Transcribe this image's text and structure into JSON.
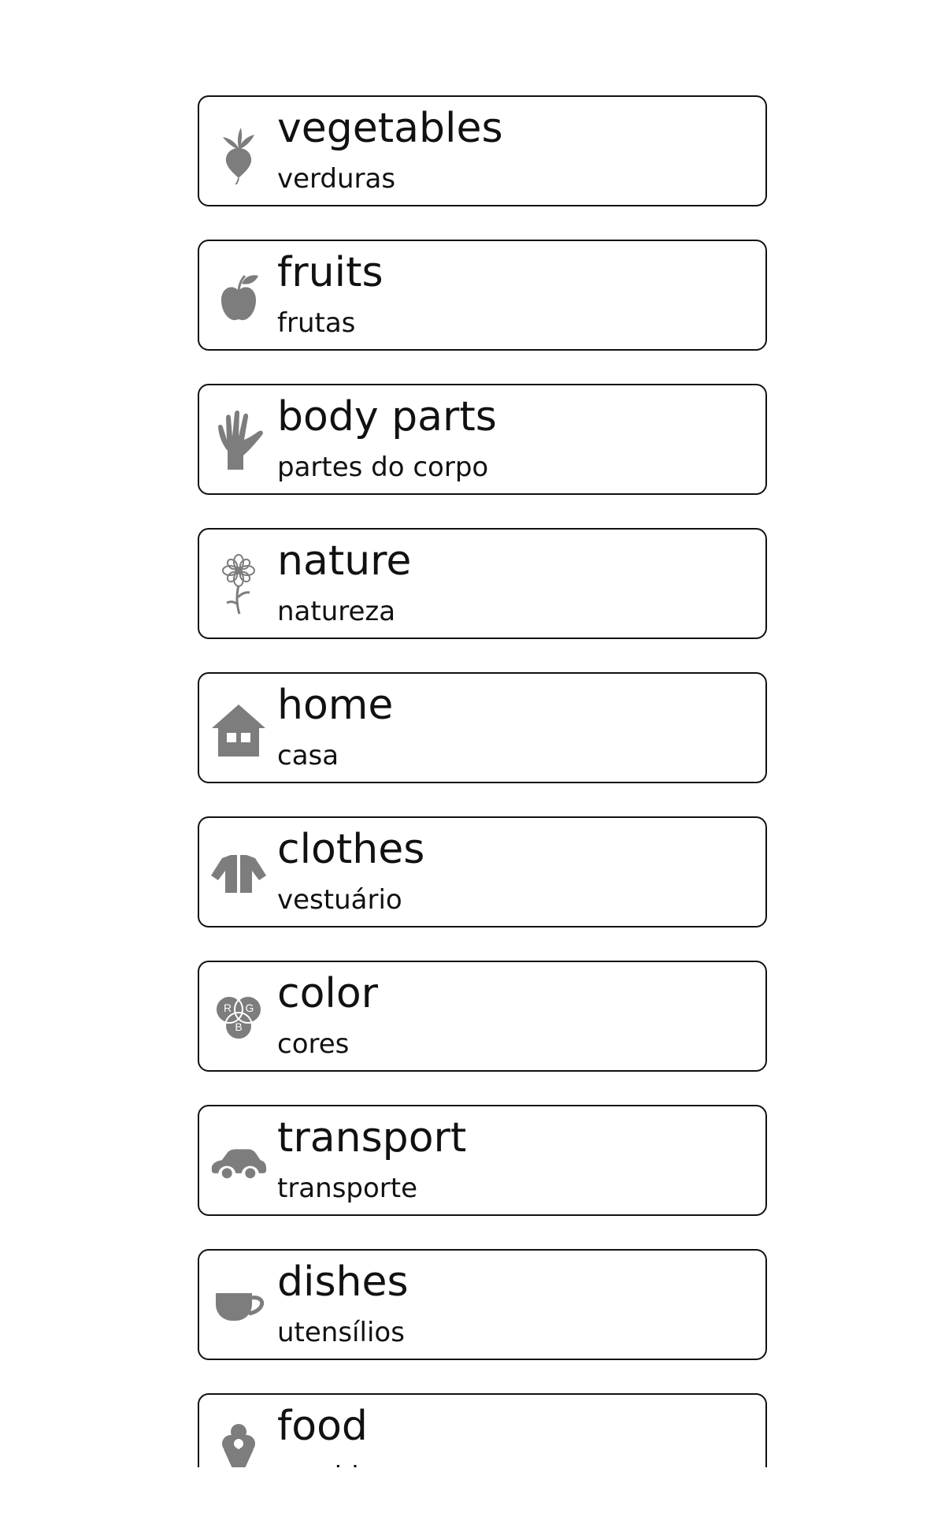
{
  "categories": [
    {
      "title": "vegetables",
      "subtitle": "verduras",
      "icon": "radish-icon"
    },
    {
      "title": "fruits",
      "subtitle": "frutas",
      "icon": "apple-icon"
    },
    {
      "title": "body parts",
      "subtitle": "partes do corpo",
      "icon": "hand-icon"
    },
    {
      "title": "nature",
      "subtitle": "natureza",
      "icon": "flower-icon"
    },
    {
      "title": "home",
      "subtitle": "casa",
      "icon": "house-icon"
    },
    {
      "title": "clothes",
      "subtitle": "vestuário",
      "icon": "jacket-icon"
    },
    {
      "title": "color",
      "subtitle": "cores",
      "icon": "rgb-circles-icon",
      "icon_letters": [
        "R",
        "G",
        "B"
      ]
    },
    {
      "title": "transport",
      "subtitle": "transporte",
      "icon": "car-icon"
    },
    {
      "title": "dishes",
      "subtitle": "utensílios",
      "icon": "cup-icon"
    },
    {
      "title": "food",
      "subtitle": "comida",
      "icon": "ice-cream-icon"
    }
  ],
  "colors": {
    "icon_gray": "#7d7d7d",
    "border": "#111111",
    "text": "#111111",
    "background": "#ffffff"
  }
}
